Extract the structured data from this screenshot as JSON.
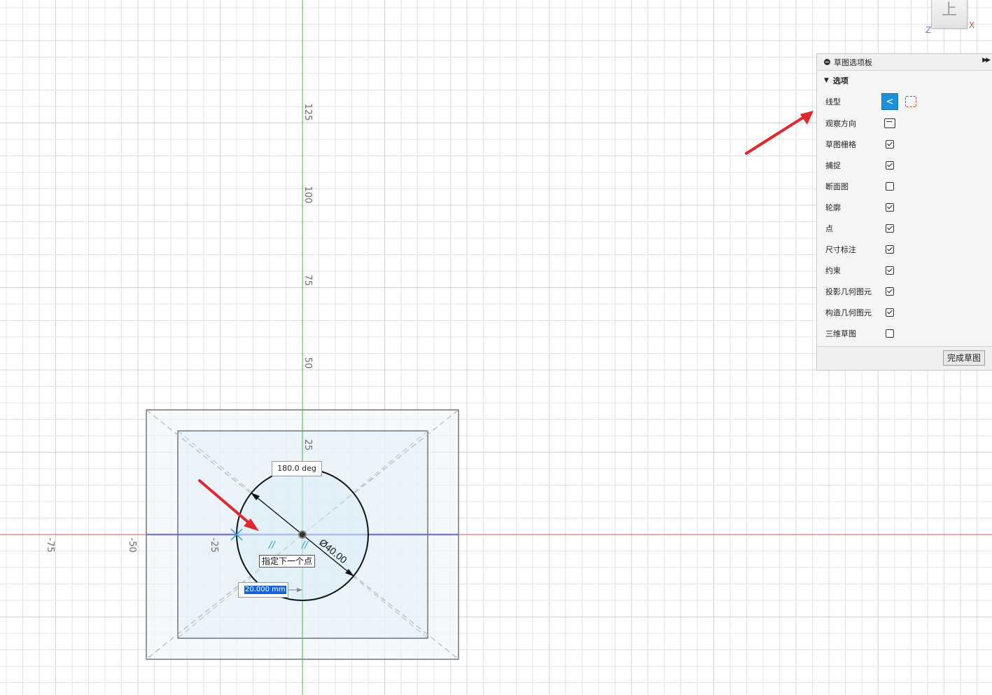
{
  "viewcube": {
    "face_label": "上",
    "axis_z": "Z",
    "axis_x": "X"
  },
  "axis_ticks": {
    "vertical": [
      "125",
      "100",
      "75",
      "50",
      "25"
    ],
    "horizontal": [
      "-75",
      "-50",
      "-25"
    ]
  },
  "sketch": {
    "angle_readout": "180.0 deg",
    "diameter_label": "Ø40.00",
    "tooltip": "指定下一个点",
    "length_input": "20.000 mm"
  },
  "palette": {
    "title": "草图选项板",
    "section": "选项",
    "rows": [
      {
        "label": "线型"
      },
      {
        "label": "观察方向"
      },
      {
        "label": "草图栅格",
        "checked": true
      },
      {
        "label": "捕捉",
        "checked": true
      },
      {
        "label": "断面图",
        "checked": false
      },
      {
        "label": "轮廓",
        "checked": true
      },
      {
        "label": "点",
        "checked": true
      },
      {
        "label": "尺寸标注",
        "checked": true
      },
      {
        "label": "约束",
        "checked": true
      },
      {
        "label": "投影几何图元",
        "checked": true
      },
      {
        "label": "构造几何图元",
        "checked": true
      },
      {
        "label": "三维草图",
        "checked": false
      }
    ],
    "finish_button": "完成草图"
  },
  "colors": {
    "grid": "#e3e3e3",
    "x_axis": "#e05050",
    "y_axis": "#44bb44",
    "accent": "#1f8fd6",
    "annotation_arrow": "#e0282e"
  }
}
